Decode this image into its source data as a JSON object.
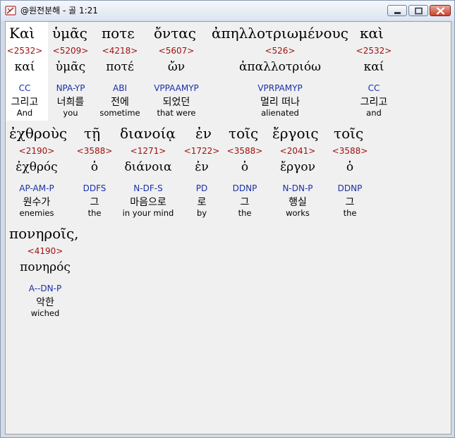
{
  "window": {
    "title": "@원전분해 - 골 1:21"
  },
  "verse_lines": [
    {
      "words": [
        {
          "greek": "Καὶ",
          "strong": "<2532>",
          "lemma": "καί",
          "parse": "CC",
          "korean": "그리고",
          "english": "And"
        },
        {
          "greek": "ὑμᾶς",
          "strong": "<5209>",
          "lemma": "ὑμᾶς",
          "parse": "NPA-YP",
          "korean": "너희를",
          "english": "you"
        },
        {
          "greek": "ποτε",
          "strong": "<4218>",
          "lemma": "ποτέ",
          "parse": "ABI",
          "korean": "전에",
          "english": "sometime"
        },
        {
          "greek": "ὄντας",
          "strong": "<5607>",
          "lemma": "ὤν",
          "parse": "VPPAAMYP",
          "korean": "되었던",
          "english": "that were"
        },
        {
          "greek": "ἀπηλλοτριωμένους",
          "strong": "<526>",
          "lemma": "ἀπαλλοτριόω",
          "parse": "VPRPAMYP",
          "korean": "멀리 떠나",
          "english": "alienated"
        },
        {
          "greek": "καὶ",
          "strong": "<2532>",
          "lemma": "καί",
          "parse": "CC",
          "korean": "그리고",
          "english": "and"
        }
      ]
    },
    {
      "words": [
        {
          "greek": "ἐχθροὺς",
          "strong": "<2190>",
          "lemma": "ἐχθρός",
          "parse": "AP-AM-P",
          "korean": "원수가",
          "english": "enemies"
        },
        {
          "greek": "τῇ",
          "strong": "<3588>",
          "lemma": "ὁ",
          "parse": "DDFS",
          "korean": "그",
          "english": "the"
        },
        {
          "greek": "διανοίᾳ",
          "strong": "<1271>",
          "lemma": "διάνοια",
          "parse": "N-DF-S",
          "korean": "마음으로",
          "english": "in your mind"
        },
        {
          "greek": "ἐν",
          "strong": "<1722>",
          "lemma": "ἐν",
          "parse": "PD",
          "korean": "로",
          "english": "by"
        },
        {
          "greek": "τοῖς",
          "strong": "<3588>",
          "lemma": "ὁ",
          "parse": "DDNP",
          "korean": "그",
          "english": "the"
        },
        {
          "greek": "ἔργοις",
          "strong": "<2041>",
          "lemma": "ἔργον",
          "parse": "N-DN-P",
          "korean": "행실",
          "english": "works"
        },
        {
          "greek": "τοῖς",
          "strong": "<3588>",
          "lemma": "ὁ",
          "parse": "DDNP",
          "korean": "그",
          "english": "the"
        }
      ]
    },
    {
      "words": [
        {
          "greek": "πονηροῖς,",
          "strong": "<4190>",
          "lemma": "πονηρός",
          "parse": "A--DN-P",
          "korean": "악한",
          "english": "wiched"
        }
      ]
    }
  ],
  "colors": {
    "strong": "#a01010",
    "parse": "#1a2fa8",
    "background": "#f0f0f0",
    "selection": "#ffffff"
  },
  "icons": {
    "app": "bible-icon",
    "minimize": "minimize-icon",
    "maximize": "maximize-icon",
    "close": "close-icon"
  }
}
